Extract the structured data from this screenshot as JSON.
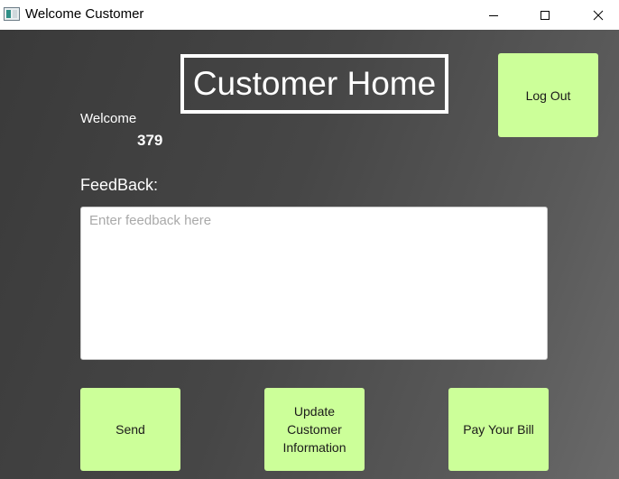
{
  "window": {
    "title": "Welcome Customer"
  },
  "header": {
    "title": "Customer Home",
    "logout_label": "Log Out"
  },
  "welcome": {
    "label": "Welcome",
    "customer_id": "379"
  },
  "feedback": {
    "label": "FeedBack:",
    "placeholder": "Enter feedback here",
    "value": ""
  },
  "actions": {
    "send_label": "Send",
    "update_label": "Update\nCustomer\nInformation",
    "pay_label": "Pay Your Bill"
  },
  "colors": {
    "button_green": "#ccff99",
    "background_dark": "#3a3a3a"
  }
}
